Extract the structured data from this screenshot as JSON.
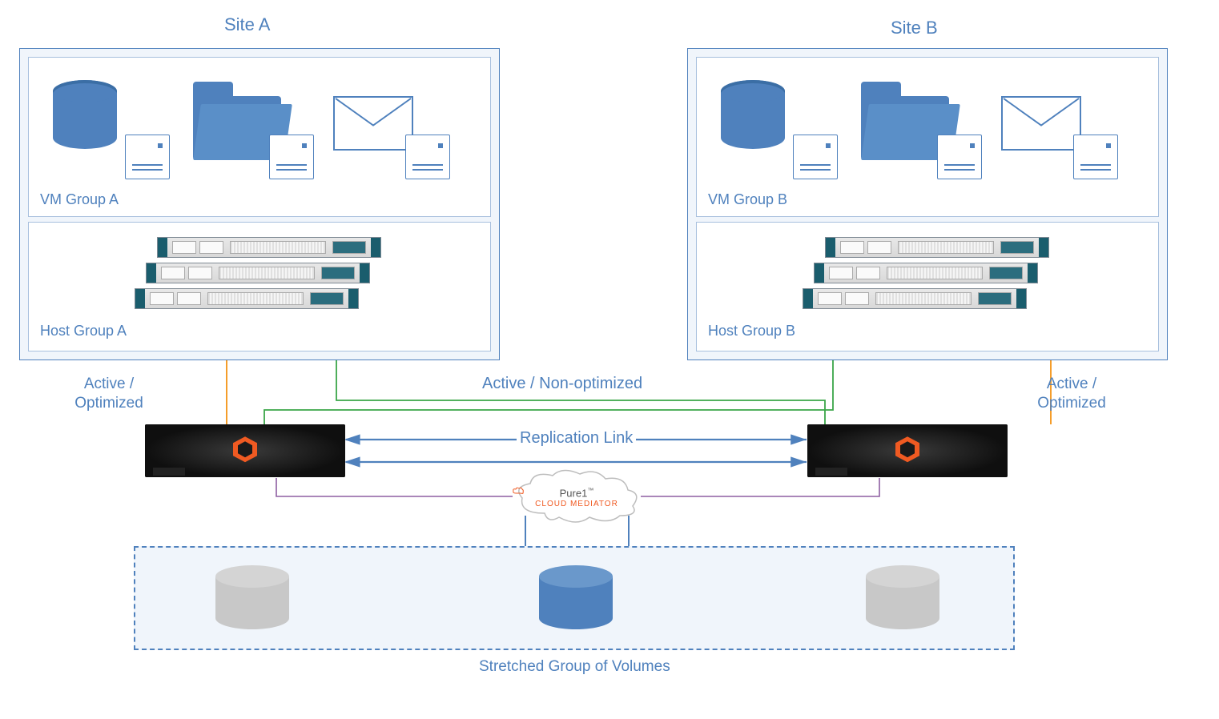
{
  "titles": {
    "siteA": "Site A",
    "siteB": "Site B"
  },
  "groups": {
    "vmA": "VM Group A",
    "vmB": "VM Group B",
    "hostA": "Host Group A",
    "hostB": "Host Group B"
  },
  "labels": {
    "activeOptimizedA": "Active /\nOptimized",
    "activeOptimizedB": "Active /\nOptimized",
    "activeNonOptimized": "Active / Non-optimized",
    "replicationLink": "Replication Link",
    "stretched": "Stretched Group of Volumes"
  },
  "mediator": {
    "brand": "Pure1",
    "tm": "™",
    "sub": "CLOUD MEDIATOR"
  },
  "icons": {
    "database": "database-icon",
    "folder": "folder-icon",
    "mail": "mail-icon",
    "host": "host-icon",
    "server": "server-rack",
    "storage": "storage-array",
    "cloud": "cloud-mediator",
    "volume": "volume-cylinder"
  },
  "colors": {
    "primary": "#4f81bd",
    "green": "#3aa648",
    "orange": "#f59d2a",
    "purple": "#8e5ea2",
    "brandOrange": "#f05a22"
  }
}
